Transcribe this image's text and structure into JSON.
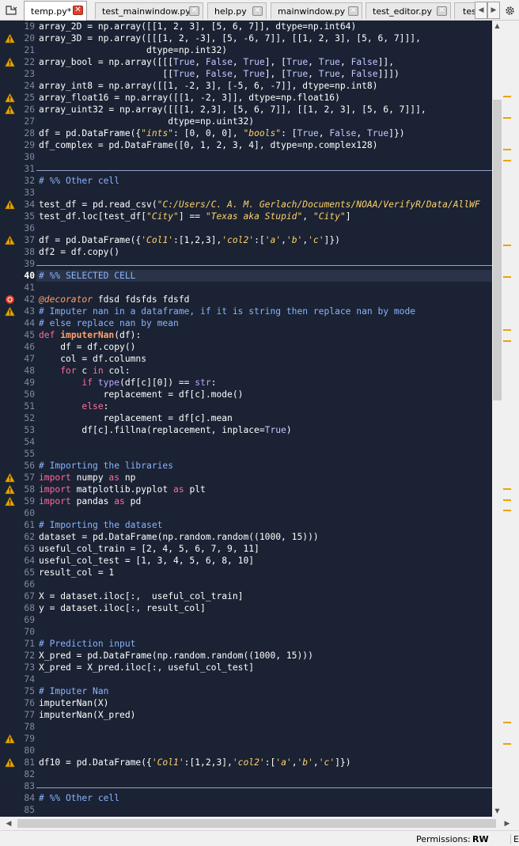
{
  "tabs": [
    {
      "label": "temp.py*",
      "active": true
    },
    {
      "label": "test_mainwindow.py",
      "active": false
    },
    {
      "label": "help.py",
      "active": false
    },
    {
      "label": "mainwindow.py",
      "active": false
    },
    {
      "label": "test_editor.py",
      "active": false
    },
    {
      "label": "tes",
      "active": false
    }
  ],
  "status": {
    "permissions_label": "Permissions:",
    "permissions_value": "RW",
    "end_label": "En"
  },
  "colors": {
    "editor_bg": "#1a2233",
    "warning": "#e8a400",
    "error": "#d9412e"
  },
  "lines": [
    {
      "n": "19",
      "icon": "",
      "t": [
        [
          "array_2D = np.array([[1, 2, 3], [5, 6, 7]], dtype=np.int64)",
          ""
        ]
      ]
    },
    {
      "n": "20",
      "icon": "warning",
      "t": [
        [
          "array_3D = np.array([[[1, 2, -3], [5, -6, 7]], [[1, 2, 3], [5, 6, 7]]],",
          ""
        ]
      ]
    },
    {
      "n": "21",
      "icon": "",
      "t": [
        [
          "                    dtype=np.int32)",
          ""
        ]
      ]
    },
    {
      "n": "22",
      "icon": "warning",
      "t": [
        [
          "array_bool = np.array([[[",
          ""
        ],
        [
          "True",
          "k"
        ],
        [
          ", ",
          ""
        ],
        [
          "False",
          "k"
        ],
        [
          ", ",
          ""
        ],
        [
          "True",
          "k"
        ],
        [
          "], [",
          ""
        ],
        [
          "True",
          "k"
        ],
        [
          ", ",
          ""
        ],
        [
          "True",
          "k"
        ],
        [
          ", ",
          ""
        ],
        [
          "False",
          "k"
        ],
        [
          "]],",
          ""
        ]
      ]
    },
    {
      "n": "23",
      "icon": "",
      "t": [
        [
          "                       [[",
          ""
        ],
        [
          "True",
          "k"
        ],
        [
          ", ",
          ""
        ],
        [
          "False",
          "k"
        ],
        [
          ", ",
          ""
        ],
        [
          "True",
          "k"
        ],
        [
          "], [",
          ""
        ],
        [
          "True",
          "k"
        ],
        [
          ", ",
          ""
        ],
        [
          "True",
          "k"
        ],
        [
          ", ",
          ""
        ],
        [
          "False",
          "k"
        ],
        [
          "]]])",
          ""
        ]
      ]
    },
    {
      "n": "24",
      "icon": "",
      "t": [
        [
          "array_int8 = np.array([[1, -2, 3], [-5, 6, -7]], dtype=np.int8)",
          ""
        ]
      ]
    },
    {
      "n": "25",
      "icon": "warning",
      "t": [
        [
          "array_float16 = np.array([[1, -2, 3]], dtype=np.float16)",
          ""
        ]
      ]
    },
    {
      "n": "26",
      "icon": "warning",
      "t": [
        [
          "array_uint32 = np.array([[[1, 2,3], [5, 6, 7]], [[1, 2, 3], [5, 6, 7]]],",
          ""
        ]
      ]
    },
    {
      "n": "27",
      "icon": "",
      "t": [
        [
          "                        dtype=np.uint32)",
          ""
        ]
      ]
    },
    {
      "n": "28",
      "icon": "",
      "t": [
        [
          "df = pd.DataFrame({",
          ""
        ],
        [
          "\"ints\"",
          "s"
        ],
        [
          ": [0, 0, 0], ",
          ""
        ],
        [
          "\"bools\"",
          "s"
        ],
        [
          ": [",
          ""
        ],
        [
          "True",
          "k"
        ],
        [
          ", ",
          ""
        ],
        [
          "False",
          "k"
        ],
        [
          ", ",
          ""
        ],
        [
          "True",
          "k"
        ],
        [
          "]})",
          ""
        ]
      ]
    },
    {
      "n": "29",
      "icon": "",
      "t": [
        [
          "df_complex = pd.DataFrame([0, 1, 2, 3, 4], dtype=np.complex128)",
          ""
        ]
      ]
    },
    {
      "n": "30",
      "icon": "",
      "t": []
    },
    {
      "n": "31",
      "icon": "",
      "t": [],
      "sep": true
    },
    {
      "n": "32",
      "icon": "",
      "t": [
        [
          "# %% Other cell",
          "c"
        ]
      ]
    },
    {
      "n": "33",
      "icon": "",
      "t": []
    },
    {
      "n": "34",
      "icon": "warning",
      "t": [
        [
          "test_df = pd.read_csv(",
          ""
        ],
        [
          "\"C:/Users/C. A. M. Gerlach/Documents/NOAA/VerifyR/Data/AllWF",
          "s"
        ]
      ]
    },
    {
      "n": "35",
      "icon": "",
      "t": [
        [
          "test_df.loc[test_df[",
          ""
        ],
        [
          "\"City\"",
          "s"
        ],
        [
          "] == ",
          ""
        ],
        [
          "\"Texas aka Stupid\"",
          "s"
        ],
        [
          ", ",
          ""
        ],
        [
          "\"City\"",
          "s"
        ],
        [
          "]",
          ""
        ]
      ]
    },
    {
      "n": "36",
      "icon": "",
      "t": []
    },
    {
      "n": "37",
      "icon": "warning",
      "t": [
        [
          "df = pd.DataFrame({",
          ""
        ],
        [
          "'Col1'",
          "s"
        ],
        [
          ":[1,2,3],",
          ""
        ],
        [
          "'col2'",
          "s"
        ],
        [
          ":[",
          ""
        ],
        [
          "'a'",
          "s"
        ],
        [
          ",",
          ""
        ],
        [
          "'b'",
          "s"
        ],
        [
          ",",
          ""
        ],
        [
          "'c'",
          "s"
        ],
        [
          "]})",
          ""
        ]
      ]
    },
    {
      "n": "38",
      "icon": "",
      "t": [
        [
          "df2 = df.copy()",
          ""
        ]
      ]
    },
    {
      "n": "39",
      "icon": "",
      "t": [],
      "sep": true
    },
    {
      "n": "40",
      "icon": "",
      "t": [
        [
          "# %% SELECTED CELL",
          "c"
        ]
      ],
      "cur": true
    },
    {
      "n": "41",
      "icon": "",
      "t": []
    },
    {
      "n": "42",
      "icon": "error",
      "t": [
        [
          "@decorator",
          "dec"
        ],
        [
          " fdsd fdsfds fdsfd",
          ""
        ]
      ]
    },
    {
      "n": "43",
      "icon": "warning",
      "t": [
        [
          "# Imputer nan in a dataframe, if it is string then replace nan by mode",
          "c"
        ]
      ]
    },
    {
      "n": "44",
      "icon": "",
      "t": [
        [
          "# else replace nan by mean",
          "c"
        ]
      ]
    },
    {
      "n": "45",
      "icon": "",
      "t": [
        [
          "def ",
          "kw"
        ],
        [
          "imputerNan",
          "f"
        ],
        [
          "(df):",
          ""
        ]
      ]
    },
    {
      "n": "46",
      "icon": "",
      "t": [
        [
          "    df = df.copy()",
          ""
        ]
      ]
    },
    {
      "n": "47",
      "icon": "",
      "t": [
        [
          "    col = df.columns",
          ""
        ]
      ]
    },
    {
      "n": "48",
      "icon": "",
      "t": [
        [
          "    ",
          ""
        ],
        [
          "for",
          "kw"
        ],
        [
          " c ",
          ""
        ],
        [
          "in",
          "kw"
        ],
        [
          " col:",
          ""
        ]
      ]
    },
    {
      "n": "49",
      "icon": "",
      "t": [
        [
          "        ",
          ""
        ],
        [
          "if",
          "kw"
        ],
        [
          " ",
          ""
        ],
        [
          "type",
          "b"
        ],
        [
          "(df[c][0]) == ",
          ""
        ],
        [
          "str",
          "b"
        ],
        [
          ":",
          ""
        ]
      ]
    },
    {
      "n": "50",
      "icon": "",
      "t": [
        [
          "            replacement = df[c].mode()",
          ""
        ]
      ]
    },
    {
      "n": "51",
      "icon": "",
      "t": [
        [
          "        ",
          ""
        ],
        [
          "else",
          "kw"
        ],
        [
          ":",
          ""
        ]
      ]
    },
    {
      "n": "52",
      "icon": "",
      "t": [
        [
          "            replacement = df[c].mean",
          ""
        ]
      ]
    },
    {
      "n": "53",
      "icon": "",
      "t": [
        [
          "        df[c].fillna(replacement, inplace=",
          ""
        ],
        [
          "True",
          "k"
        ],
        [
          ")",
          ""
        ]
      ]
    },
    {
      "n": "54",
      "icon": "",
      "t": []
    },
    {
      "n": "55",
      "icon": "",
      "t": []
    },
    {
      "n": "56",
      "icon": "",
      "t": [
        [
          "# Importing the libraries",
          "c"
        ]
      ]
    },
    {
      "n": "57",
      "icon": "warning",
      "t": [
        [
          "import",
          "kw"
        ],
        [
          " numpy ",
          ""
        ],
        [
          "as",
          "kw"
        ],
        [
          " np",
          ""
        ]
      ]
    },
    {
      "n": "58",
      "icon": "warning",
      "t": [
        [
          "import",
          "kw"
        ],
        [
          " matplotlib.pyplot ",
          ""
        ],
        [
          "as",
          "kw"
        ],
        [
          " plt",
          ""
        ]
      ]
    },
    {
      "n": "59",
      "icon": "warning",
      "t": [
        [
          "import",
          "kw"
        ],
        [
          " pandas ",
          ""
        ],
        [
          "as",
          "kw"
        ],
        [
          " pd",
          ""
        ]
      ]
    },
    {
      "n": "60",
      "icon": "",
      "t": []
    },
    {
      "n": "61",
      "icon": "",
      "t": [
        [
          "# Importing the dataset",
          "c"
        ]
      ]
    },
    {
      "n": "62",
      "icon": "",
      "t": [
        [
          "dataset = pd.DataFrame(np.random.random((1000, 15)))",
          ""
        ]
      ]
    },
    {
      "n": "63",
      "icon": "",
      "t": [
        [
          "useful_col_train = [2, 4, 5, 6, 7, 9, 11]",
          ""
        ]
      ]
    },
    {
      "n": "64",
      "icon": "",
      "t": [
        [
          "useful_col_test = [1, 3, 4, 5, 6, 8, 10]",
          ""
        ]
      ]
    },
    {
      "n": "65",
      "icon": "",
      "t": [
        [
          "result_col = 1",
          ""
        ]
      ]
    },
    {
      "n": "66",
      "icon": "",
      "t": []
    },
    {
      "n": "67",
      "icon": "",
      "t": [
        [
          "X = dataset.iloc[:,  useful_col_train]",
          ""
        ]
      ]
    },
    {
      "n": "68",
      "icon": "",
      "t": [
        [
          "y = dataset.iloc[:, result_col]",
          ""
        ]
      ]
    },
    {
      "n": "69",
      "icon": "",
      "t": []
    },
    {
      "n": "70",
      "icon": "",
      "t": []
    },
    {
      "n": "71",
      "icon": "",
      "t": [
        [
          "# Prediction input",
          "c"
        ]
      ]
    },
    {
      "n": "72",
      "icon": "",
      "t": [
        [
          "X_pred = pd.DataFrame(np.random.random((1000, 15)))",
          ""
        ]
      ]
    },
    {
      "n": "73",
      "icon": "",
      "t": [
        [
          "X_pred = X_pred.iloc[:, useful_col_test]",
          ""
        ]
      ]
    },
    {
      "n": "74",
      "icon": "",
      "t": []
    },
    {
      "n": "75",
      "icon": "",
      "t": [
        [
          "# Imputer Nan",
          "c"
        ]
      ]
    },
    {
      "n": "76",
      "icon": "",
      "t": [
        [
          "imputerNan(X)",
          ""
        ]
      ]
    },
    {
      "n": "77",
      "icon": "",
      "t": [
        [
          "imputerNan(X_pred)",
          ""
        ]
      ]
    },
    {
      "n": "78",
      "icon": "",
      "t": []
    },
    {
      "n": "79",
      "icon": "warning",
      "t": []
    },
    {
      "n": "80",
      "icon": "",
      "t": []
    },
    {
      "n": "81",
      "icon": "warning",
      "t": [
        [
          "df10 = pd.DataFrame({",
          ""
        ],
        [
          "'Col1'",
          "s"
        ],
        [
          ":[1,2,3],",
          ""
        ],
        [
          "'col2'",
          "s"
        ],
        [
          ":[",
          ""
        ],
        [
          "'a'",
          "s"
        ],
        [
          ",",
          ""
        ],
        [
          "'b'",
          "s"
        ],
        [
          ",",
          ""
        ],
        [
          "'c'",
          "s"
        ],
        [
          "]})",
          ""
        ]
      ]
    },
    {
      "n": "82",
      "icon": "",
      "t": []
    },
    {
      "n": "83",
      "icon": "",
      "t": [],
      "sep": true
    },
    {
      "n": "84",
      "icon": "",
      "t": [
        [
          "# %% Other cell",
          "c"
        ]
      ]
    },
    {
      "n": "85",
      "icon": "",
      "t": []
    }
  ]
}
